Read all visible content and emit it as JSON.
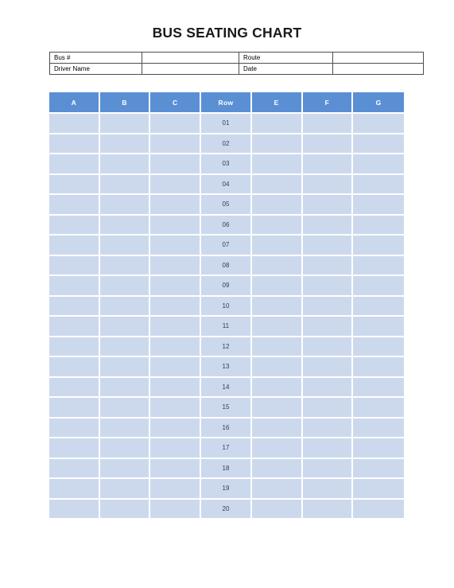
{
  "document": {
    "title": "BUS SEATING CHART"
  },
  "info": {
    "rows": [
      {
        "label1": "Bus #",
        "value1": "",
        "label2": "Route",
        "value2": ""
      },
      {
        "label1": "Driver Name",
        "value1": "",
        "label2": "Date",
        "value2": ""
      }
    ]
  },
  "seating": {
    "columns": [
      "A",
      "B",
      "C",
      "Row",
      "E",
      "F",
      "G"
    ],
    "row_labels": [
      "01",
      "02",
      "03",
      "04",
      "05",
      "06",
      "07",
      "08",
      "09",
      "10",
      "11",
      "12",
      "13",
      "14",
      "15",
      "16",
      "17",
      "18",
      "19",
      "20"
    ],
    "seat_values": [
      [
        "",
        "",
        "",
        "",
        "",
        "",
        ""
      ],
      [
        "",
        "",
        "",
        "",
        "",
        "",
        ""
      ],
      [
        "",
        "",
        "",
        "",
        "",
        "",
        ""
      ],
      [
        "",
        "",
        "",
        "",
        "",
        "",
        ""
      ],
      [
        "",
        "",
        "",
        "",
        "",
        "",
        ""
      ],
      [
        "",
        "",
        "",
        "",
        "",
        "",
        ""
      ],
      [
        "",
        "",
        "",
        "",
        "",
        "",
        ""
      ],
      [
        "",
        "",
        "",
        "",
        "",
        "",
        ""
      ],
      [
        "",
        "",
        "",
        "",
        "",
        "",
        ""
      ],
      [
        "",
        "",
        "",
        "",
        "",
        "",
        ""
      ],
      [
        "",
        "",
        "",
        "",
        "",
        "",
        ""
      ],
      [
        "",
        "",
        "",
        "",
        "",
        "",
        ""
      ],
      [
        "",
        "",
        "",
        "",
        "",
        "",
        ""
      ],
      [
        "",
        "",
        "",
        "",
        "",
        "",
        ""
      ],
      [
        "",
        "",
        "",
        "",
        "",
        "",
        ""
      ],
      [
        "",
        "",
        "",
        "",
        "",
        "",
        ""
      ],
      [
        "",
        "",
        "",
        "",
        "",
        "",
        ""
      ],
      [
        "",
        "",
        "",
        "",
        "",
        "",
        ""
      ],
      [
        "",
        "",
        "",
        "",
        "",
        "",
        ""
      ],
      [
        "",
        "",
        "",
        "",
        "",
        "",
        ""
      ]
    ],
    "row_label_column_index": 3
  },
  "colors": {
    "header_blue": "#5b8fd4",
    "cell_blue": "#ccd9ed",
    "gridline": "#ffffff",
    "info_border": "#4d4d4d",
    "text_dark": "#333f4f"
  }
}
